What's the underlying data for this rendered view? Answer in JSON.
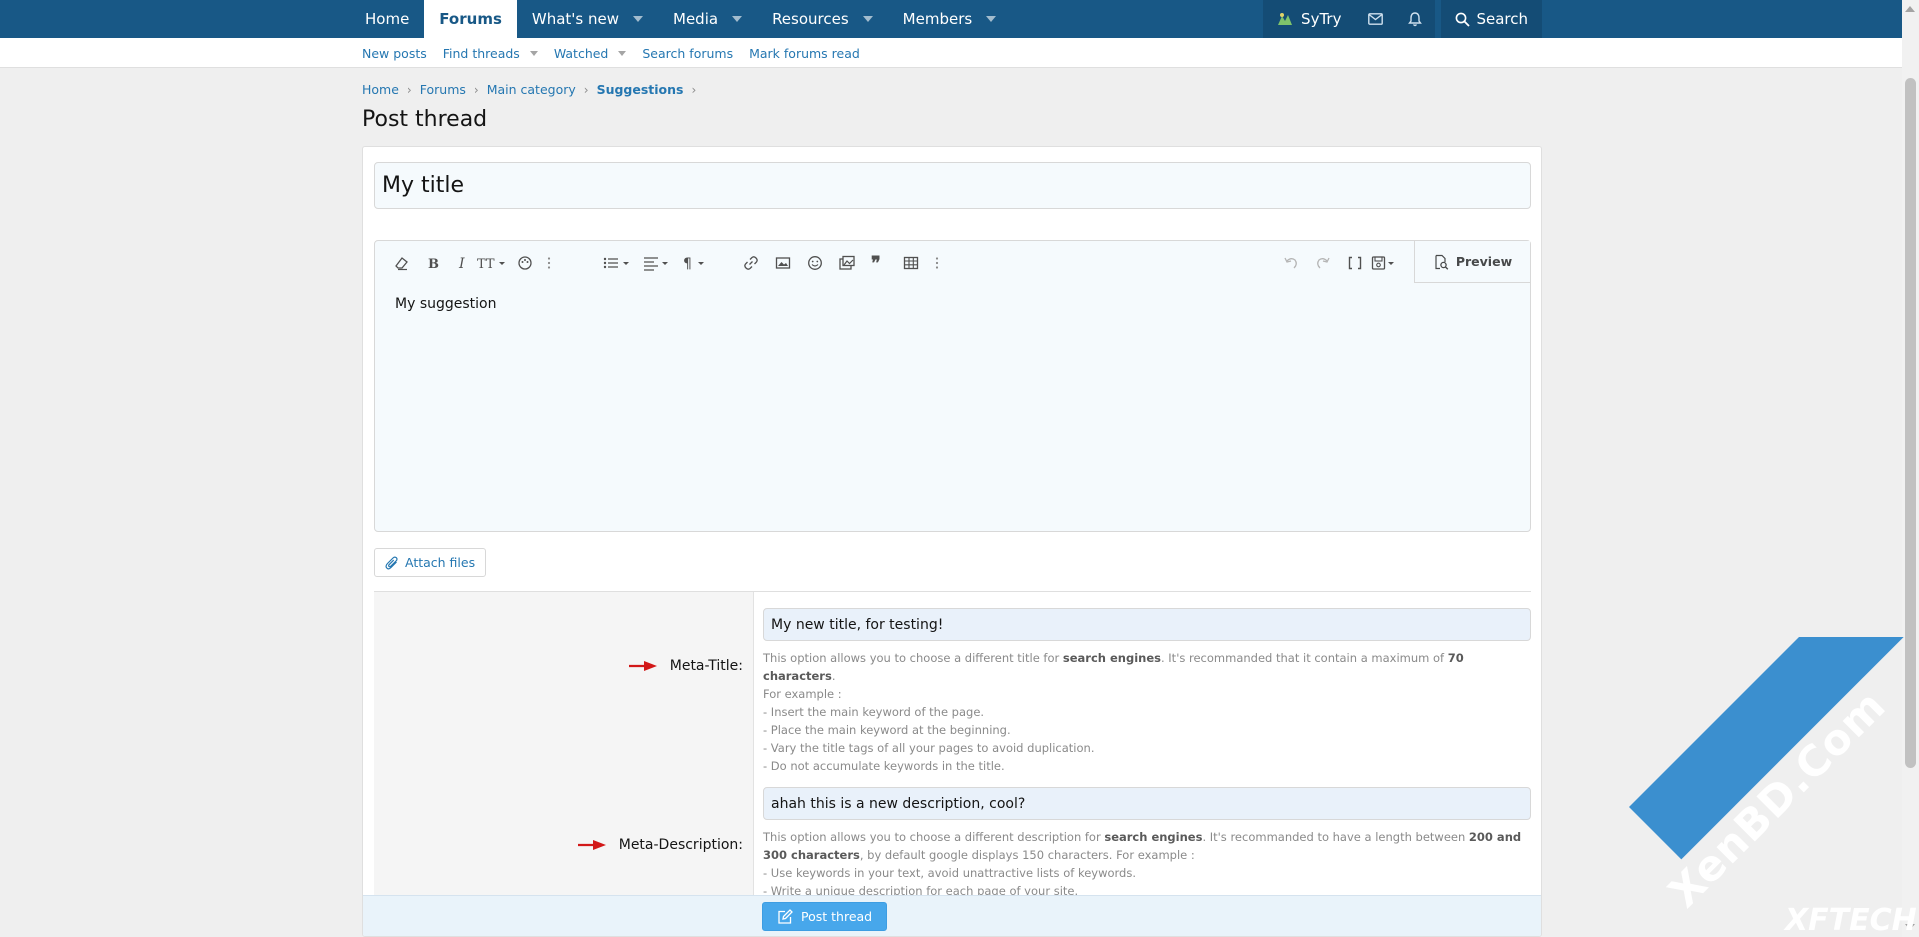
{
  "nav": {
    "tabs": [
      {
        "label": "Home"
      },
      {
        "label": "Forums"
      },
      {
        "label": "What's new"
      },
      {
        "label": "Media"
      },
      {
        "label": "Resources"
      },
      {
        "label": "Members"
      }
    ],
    "user_label": "SyTry",
    "search_label": "Search"
  },
  "subnav": {
    "links": [
      {
        "label": "New posts"
      },
      {
        "label": "Find threads"
      },
      {
        "label": "Watched"
      },
      {
        "label": "Search forums"
      },
      {
        "label": "Mark forums read"
      }
    ]
  },
  "breadcrumb": [
    "Home",
    "Forums",
    "Main category",
    "Suggestions"
  ],
  "page_title": "Post thread",
  "form": {
    "title_value": "My title",
    "editor_text": "My suggestion",
    "preview_label": "Preview",
    "attach_label": "Attach files",
    "meta_title_label": "Meta-Title:",
    "meta_title_value": "My new title, for testing!",
    "meta_title_hint": {
      "a": "This option allows you to choose a different title for ",
      "b": "search engines",
      "c": ". It's recommanded that it contain a maximum of ",
      "d": "70 characters",
      "e": ".",
      "lines": [
        "For example :",
        "- Insert the main keyword of the page.",
        "- Place the main keyword at the beginning.",
        "- Vary the title tags of all your pages to avoid duplication.",
        "- Do not accumulate keywords in the title."
      ]
    },
    "meta_desc_label": "Meta-Description:",
    "meta_desc_value": "ahah this is a new description, cool?",
    "meta_desc_hint": {
      "a": "This option allows you to choose a different description for ",
      "b": "search engines",
      "c": ". It's recommanded to have a length between ",
      "d": "200 and 300 characters",
      "e": ", by default google displays 150 characters. For example :",
      "lines": [
        "- Use keywords in your text, avoid unattractive lists of keywords.",
        "- Write a unique description for each page of your site."
      ]
    },
    "submit_label": "Post thread"
  },
  "watermark": {
    "main": "XenBD.Com",
    "sub": "XFTECH"
  },
  "colors": {
    "nav_bg": "#185886",
    "link": "#2577b1",
    "button": "#47a7eb",
    "arrow": "#d21818"
  }
}
